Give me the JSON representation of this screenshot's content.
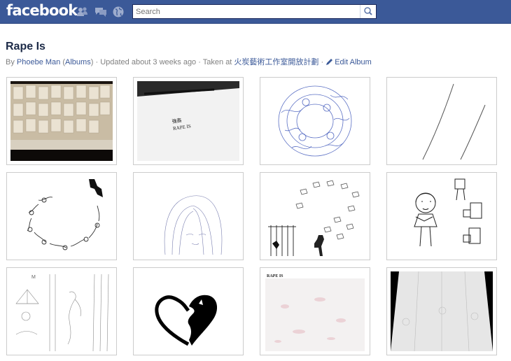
{
  "header": {
    "logo": "facebook",
    "search": {
      "placeholder": "Search",
      "value": ""
    },
    "icons": [
      "friend-requests-icon",
      "messages-icon",
      "notifications-globe-icon",
      "search-magnifier-icon"
    ]
  },
  "album": {
    "title": "Rape Is",
    "by_prefix": "By ",
    "author": "Phoebe Man",
    "albums_link": "Albums",
    "updated": "Updated about 3 weeks ago",
    "taken_prefix": "Taken at ",
    "location": "火炭藝術工作室開放計劃",
    "edit_label": "Edit Album"
  },
  "photos": {
    "p0": {
      "caption": ""
    },
    "p1": {
      "caption": "強姦\nRAPE IS"
    },
    "p10": {
      "caption": "RAPE IS"
    },
    "p8": {
      "caption": "M"
    }
  },
  "colors": {
    "topbar": "#3b5998",
    "link": "#3b5998",
    "title": "#1c2a47",
    "muted": "#808080",
    "thumb_border": "#cccccc"
  }
}
